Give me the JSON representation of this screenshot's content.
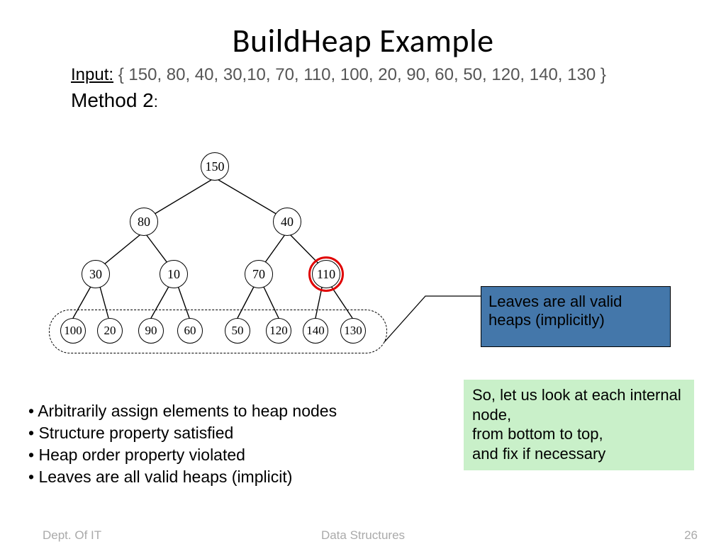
{
  "title": "BuildHeap Example",
  "input_label": "Input:",
  "input_set": "  { 150, 80, 40, 30,10, 70, 110, 100, 20, 90, 60, 50, 120, 140, 130 }",
  "method": "Method 2",
  "tree": {
    "level0": [
      "150"
    ],
    "level1": [
      "80",
      "40"
    ],
    "level2": [
      "30",
      "10",
      "70",
      "110"
    ],
    "level3": [
      "100",
      "20",
      "90",
      "60",
      "50",
      "120",
      "140",
      "130"
    ],
    "highlighted": "110"
  },
  "callout": "Leaves are all valid heaps (implicitly)",
  "greenbox": "So, let us look at each internal node,\nfrom bottom to top,\nand fix if necessary",
  "bullets": [
    "Arbitrarily assign elements to heap nodes",
    "Structure property satisfied",
    "Heap order property violated",
    "Leaves are all valid heaps (implicit)"
  ],
  "footer": {
    "left": "Dept. Of  IT",
    "center": "Data Structures",
    "page": "26"
  }
}
